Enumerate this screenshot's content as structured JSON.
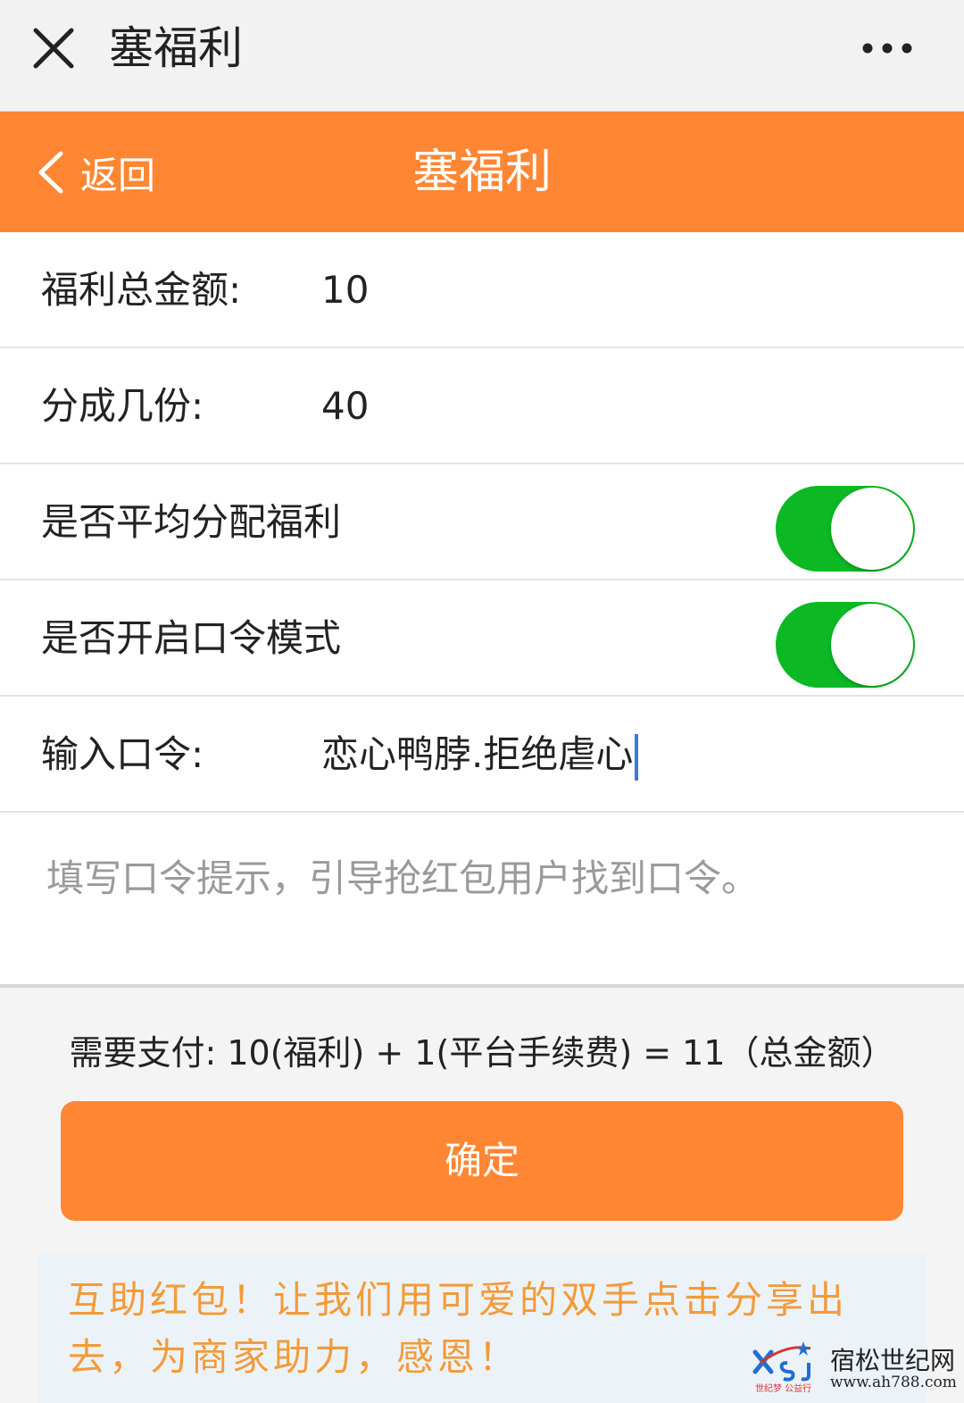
{
  "window": {
    "title": "塞福利",
    "close_icon": "close-icon",
    "more_icon": "more-dots-icon"
  },
  "navbar": {
    "back_label": "返回",
    "title": "塞福利",
    "accent_color": "#ff8633"
  },
  "form": {
    "total_amount": {
      "label": "福利总金额:",
      "value": "10"
    },
    "split_count": {
      "label": "分成几份:",
      "value": "40"
    },
    "even_split": {
      "label": "是否平均分配福利",
      "enabled": true
    },
    "password_mode": {
      "label": "是否开启口令模式",
      "enabled": true
    },
    "password": {
      "label": "输入口令:",
      "value": "恋心鸭脖.拒绝虐心"
    },
    "hint_placeholder": "填写口令提示，引导抢红包用户找到口令。",
    "switch_color": "#0cb924"
  },
  "payment": {
    "summary": "需要支付: 10(福利) + 1(平台手续费) = 11（总金额）"
  },
  "actions": {
    "confirm_label": "确定"
  },
  "promo": {
    "text": "互助红包！让我们用可爱的双手点击分享出去，为商家助力，感恩！"
  },
  "watermark": {
    "name": "宿松世纪网",
    "url": "www.ah788.com",
    "sub": "世纪梦 公益行"
  }
}
